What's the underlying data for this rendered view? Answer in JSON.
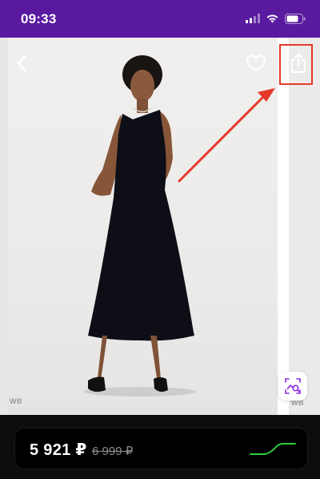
{
  "status_bar": {
    "time": "09:33",
    "icons": [
      "signal-icon",
      "wifi-icon",
      "battery-icon"
    ]
  },
  "product_image": {
    "watermark_left": "WB",
    "watermark_right": "WB"
  },
  "toolbar": {
    "back_icon": "chevron-left-icon",
    "favorite_icon": "heart-icon",
    "share_icon": "share-icon",
    "visual_search_icon": "image-search-icon"
  },
  "price": {
    "current": "5 921 ₽",
    "old": "6 999 ₽",
    "trend_icon": "price-trend-icon"
  },
  "colors": {
    "status_bar": "#5a1aa0",
    "accent_purple": "#8a2be2",
    "annotation_red": "#e53a2a",
    "trend_green": "#2ecc40"
  }
}
